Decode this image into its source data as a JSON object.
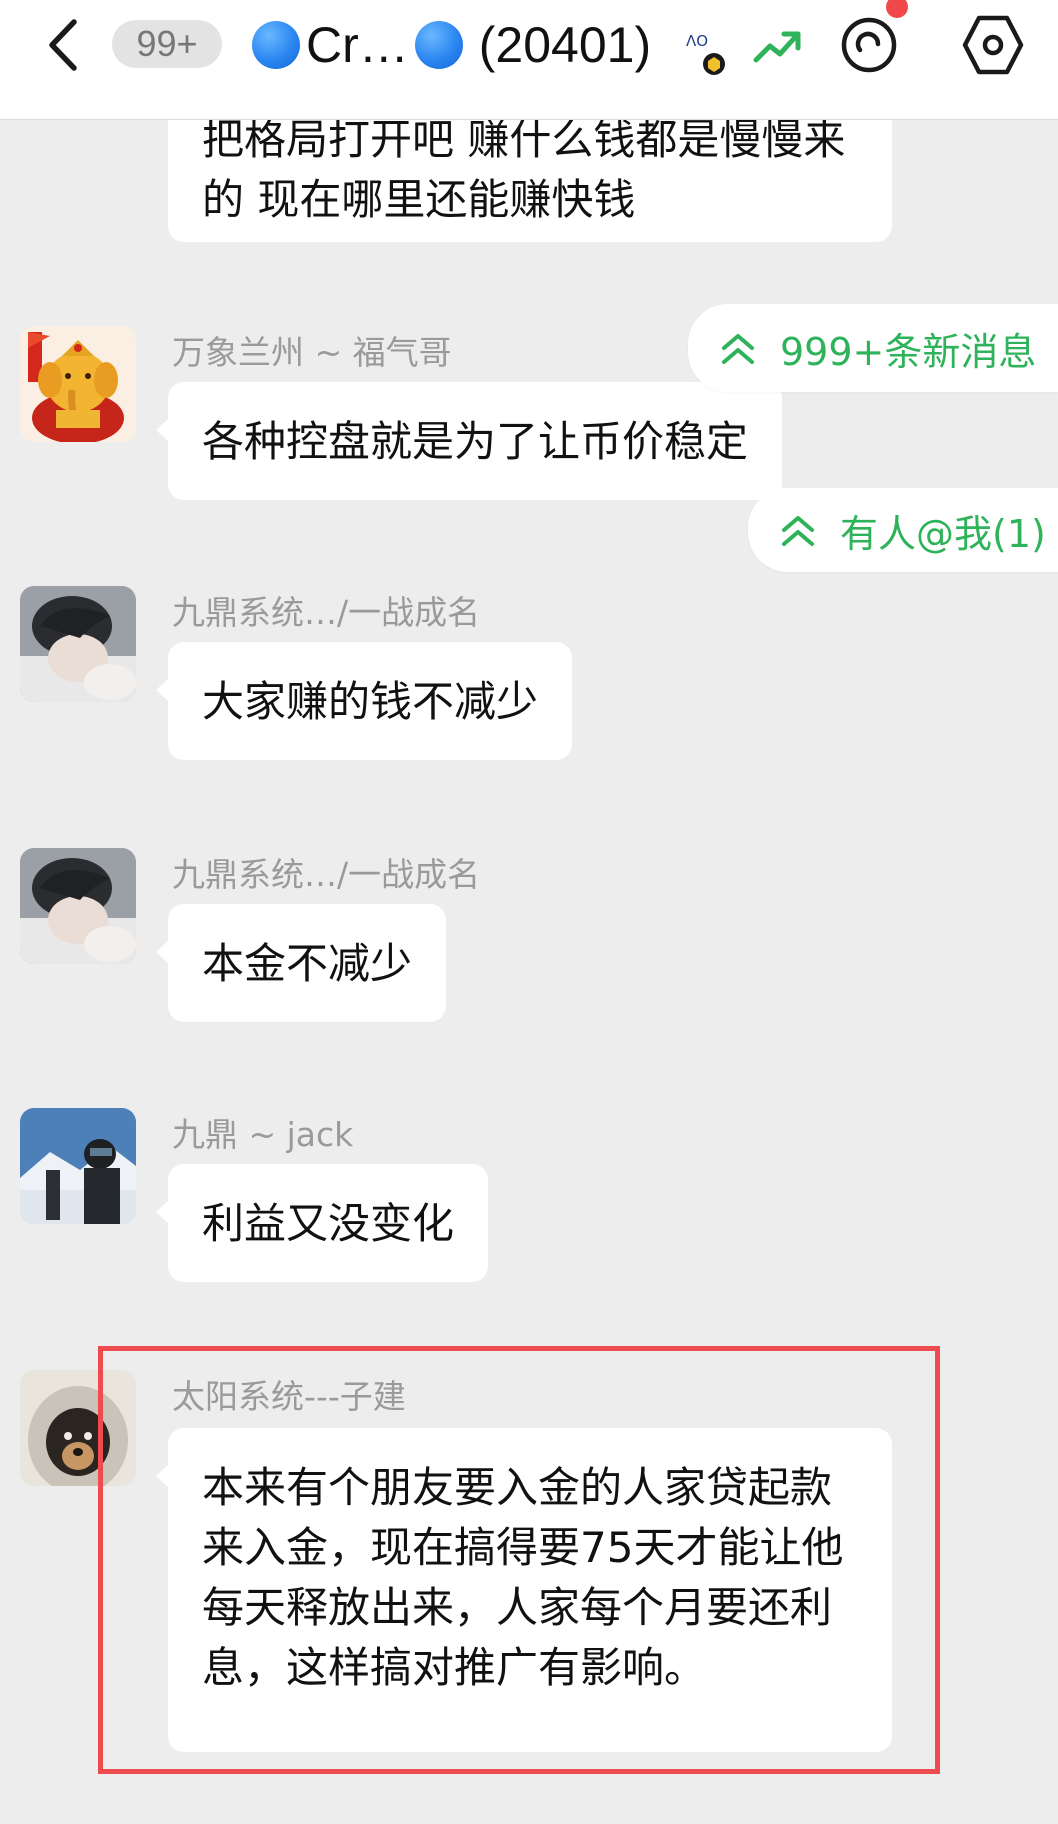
{
  "header": {
    "unread_badge": "99+",
    "title_text": "Cr…",
    "member_count": "(20401)"
  },
  "floating": {
    "new_messages": "999+条新消息",
    "mention": "有人@我(1)"
  },
  "messages": [
    {
      "sender": "",
      "text": "把格局打开吧 赚什么钱都是慢慢来的 现在哪里还能赚快钱"
    },
    {
      "sender": "万象兰州 ~ 福气哥",
      "text": "各种控盘就是为了让币价稳定"
    },
    {
      "sender": "九鼎系统…/一战成名",
      "text": "大家赚的钱不减少"
    },
    {
      "sender": "九鼎系统…/一战成名",
      "text": "本金不减少"
    },
    {
      "sender": "九鼎 ~ jack",
      "text": "利益又没变化"
    },
    {
      "sender": "太阳系统---子建",
      "text": "本来有个朋友要入金的人家贷起款来入金，现在搞得要75天才能让他每天释放出来，人家每个月要还利息，这样搞对推广有影响。"
    }
  ],
  "icons": {
    "back": "chevron-left-icon",
    "brand": "vao-brand-icon",
    "trend": "trend-up-icon",
    "spin": "refresh-circle-icon",
    "settings": "hex-settings-icon",
    "jump": "double-chevron-up-icon"
  },
  "colors": {
    "accent_green": "#2eb35a",
    "highlight_red": "#ef4b4f",
    "chat_bg": "#ededed",
    "notification_dot": "#f04848"
  }
}
